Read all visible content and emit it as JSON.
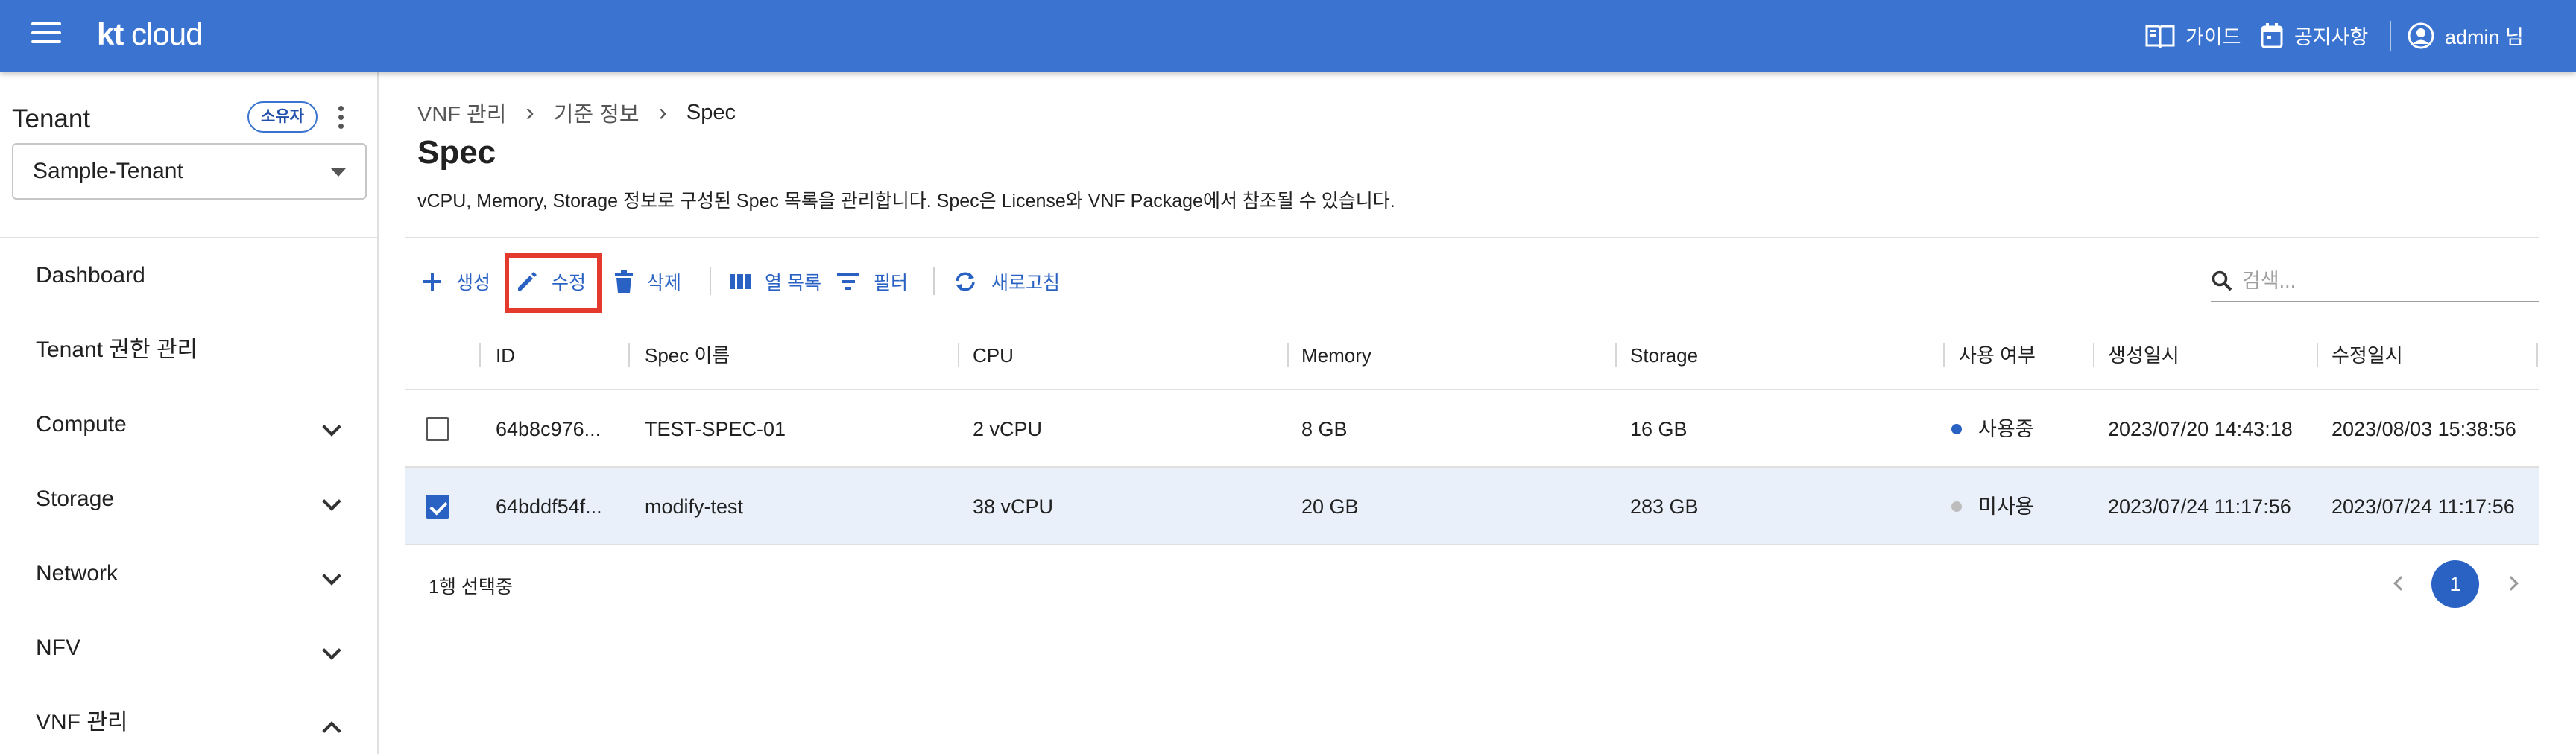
{
  "appbar": {
    "logo_bold": "kt",
    "logo_light": " cloud",
    "guide": "가이드",
    "notice": "공지사항",
    "user": "admin 님"
  },
  "sidebar": {
    "tenant_title": "Tenant",
    "owner_chip": "소유자",
    "tenant_select_value": "Sample-Tenant",
    "items": [
      {
        "label": "Dashboard",
        "expandable": false
      },
      {
        "label": "Tenant 권한 관리",
        "expandable": false
      },
      {
        "label": "Compute",
        "expandable": true,
        "expanded": false
      },
      {
        "label": "Storage",
        "expandable": true,
        "expanded": false
      },
      {
        "label": "Network",
        "expandable": true,
        "expanded": false
      },
      {
        "label": "NFV",
        "expandable": true,
        "expanded": false
      },
      {
        "label": "VNF 관리",
        "expandable": true,
        "expanded": true
      }
    ]
  },
  "breadcrumb": [
    "VNF 관리",
    "기준 정보",
    "Spec"
  ],
  "page": {
    "title": "Spec",
    "description": "vCPU, Memory, Storage 정보로 구성된 Spec 목록을 관리합니다. Spec은 License와 VNF Package에서 참조될 수 있습니다."
  },
  "toolbar": {
    "create": "생성",
    "edit": "수정",
    "delete": "삭제",
    "columns": "열 목록",
    "filter": "필터",
    "refresh": "새로고침",
    "search_placeholder": "검색..."
  },
  "table": {
    "headers": [
      "ID",
      "Spec 이름",
      "CPU",
      "Memory",
      "Storage",
      "사용 여부",
      "생성일시",
      "수정일시"
    ],
    "rows": [
      {
        "selected": false,
        "id": "64b8c976...",
        "name": "TEST-SPEC-01",
        "cpu": "2 vCPU",
        "memory": "8 GB",
        "storage": "16 GB",
        "usage": "사용중",
        "usage_color": "#2a62c4",
        "created": "2023/07/20 14:43:18",
        "modified": "2023/08/03 15:38:56"
      },
      {
        "selected": true,
        "id": "64bddf54f...",
        "name": "modify-test",
        "cpu": "38 vCPU",
        "memory": "20 GB",
        "storage": "283 GB",
        "usage": "미사용",
        "usage_color": "#bdbdbd",
        "created": "2023/07/24 11:17:56",
        "modified": "2023/07/24 11:17:56"
      }
    ]
  },
  "footer": {
    "selection_text": "1행 선택중",
    "current_page": "1"
  },
  "colors": {
    "primary": "#3a74d0",
    "accent": "#2a62c4",
    "highlight": "#e43a2d"
  }
}
